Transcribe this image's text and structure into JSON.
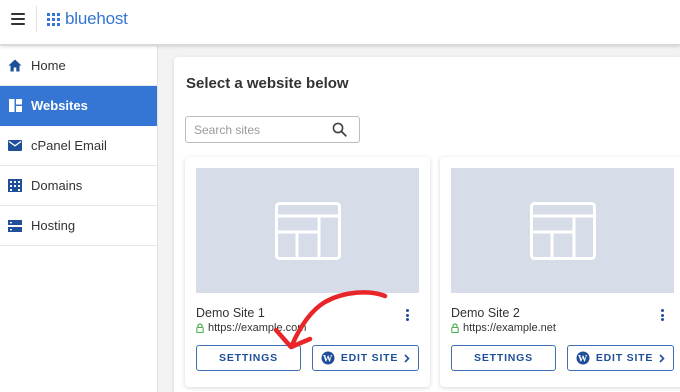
{
  "topbar": {
    "logo_text": "bluehost",
    "brand_color": "#3575d3"
  },
  "sidebar": {
    "items": [
      {
        "label": "Home",
        "icon": "home-icon",
        "active": false
      },
      {
        "label": "Websites",
        "icon": "websites-grid-icon",
        "active": true
      },
      {
        "label": "cPanel Email",
        "icon": "mail-icon",
        "active": false
      },
      {
        "label": "Domains",
        "icon": "domains-building-icon",
        "active": false
      },
      {
        "label": "Hosting",
        "icon": "hosting-server-icon",
        "active": false
      }
    ]
  },
  "main": {
    "title": "Select a website below",
    "search": {
      "placeholder": "Search sites",
      "value": ""
    },
    "sites": [
      {
        "name": "Demo Site 1",
        "url": "https://example.com",
        "settings_label": "SETTINGS",
        "edit_label": "EDIT SITE"
      },
      {
        "name": "Demo Site 2",
        "url": "https://example.net",
        "settings_label": "SETTINGS",
        "edit_label": "EDIT SITE"
      }
    ]
  },
  "colors": {
    "accent": "#3575d3",
    "button_text": "#1f4f99",
    "thumbnail_bg": "#d6dde8",
    "lock_green": "#4caf50",
    "annotation_red": "#e8262a"
  }
}
